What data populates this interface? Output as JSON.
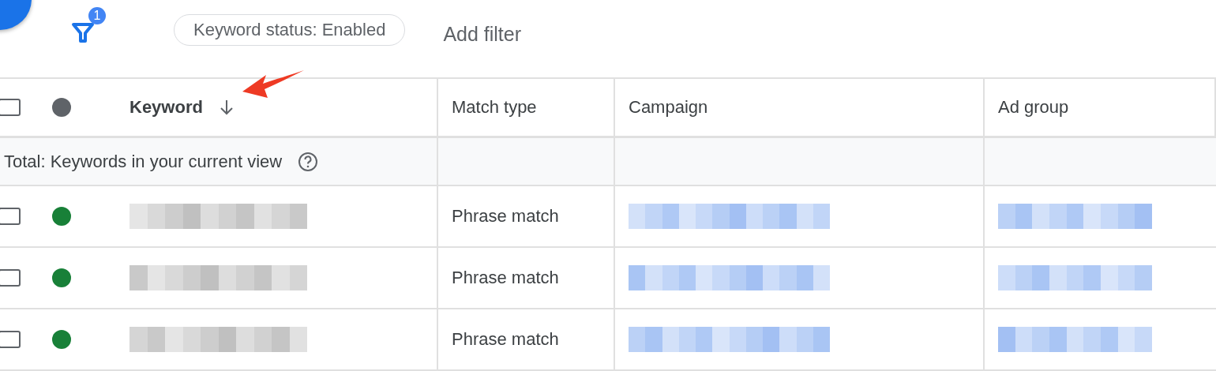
{
  "filter_bar": {
    "filter_count": "1",
    "chips": [
      {
        "label": "Keyword status: Enabled"
      }
    ],
    "add_filter": "Add filter"
  },
  "table": {
    "columns": [
      {
        "label": "Keyword",
        "sorted": true
      },
      {
        "label": "Match type",
        "sorted": false
      },
      {
        "label": "Campaign",
        "sorted": false
      },
      {
        "label": "Ad group",
        "sorted": false
      }
    ],
    "header_checkbox": {
      "checked": false
    },
    "total_row": {
      "label": "Total: Keywords in your current view"
    },
    "rows": [
      {
        "checked": false,
        "color": "#188038",
        "match_type": "Phrase match"
      },
      {
        "checked": false,
        "color": "#188038",
        "match_type": "Phrase match"
      },
      {
        "checked": false,
        "color": "#188038",
        "match_type": "Phrase match"
      }
    ]
  }
}
